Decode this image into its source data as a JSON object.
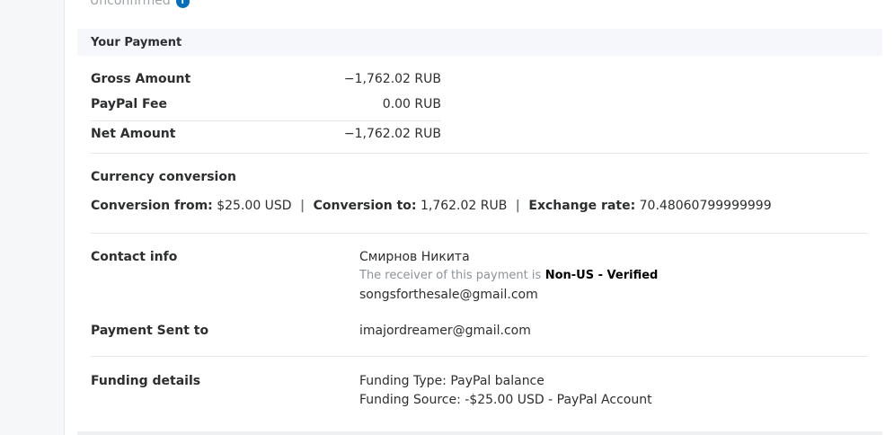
{
  "status": {
    "text": "Unconfirmed",
    "icon": "info-icon"
  },
  "payment": {
    "section_title": "Your Payment",
    "gross_label": "Gross Amount",
    "gross_value": "−1,762.02 RUB",
    "fee_label": "PayPal Fee",
    "fee_value": "0.00 RUB",
    "net_label": "Net Amount",
    "net_value": "−1,762.02 RUB"
  },
  "conversion": {
    "title": "Currency conversion",
    "from_label": "Conversion from:",
    "from_value": "$25.00 USD",
    "to_label": "Conversion to:",
    "to_value": "1,762.02 RUB",
    "rate_label": "Exchange rate:",
    "rate_value": "70.48060799999999",
    "separator": "|"
  },
  "contact": {
    "label": "Contact info",
    "name": "Смирнов Никита",
    "receiver_note": "The receiver of this payment is",
    "receiver_status": "Non-US - Verified",
    "email": "songsforthesale@gmail.com"
  },
  "sent_to": {
    "label": "Payment Sent to",
    "email": "imajordreamer@gmail.com"
  },
  "funding": {
    "label": "Funding details",
    "type_line": "Funding Type: PayPal balance",
    "source_line": "Funding Source: -$25.00 USD - PayPal Account"
  }
}
